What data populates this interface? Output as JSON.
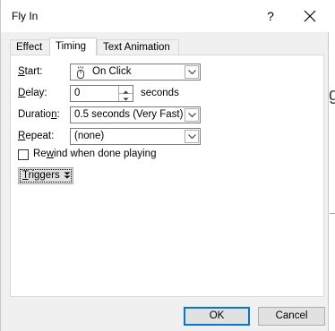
{
  "window": {
    "title": "Fly In"
  },
  "titlebar": {
    "help_label": "?"
  },
  "tabs": [
    {
      "label": "Effect",
      "active": false
    },
    {
      "label": "Timing",
      "active": true
    },
    {
      "label": "Text Animation",
      "active": false
    }
  ],
  "timing": {
    "start": {
      "label_key": "S",
      "label_rest": "tart:",
      "value": "On Click",
      "icon": "mouse-click-icon"
    },
    "delay": {
      "label_key": "D",
      "label_rest": "elay:",
      "value": "0",
      "unit": "seconds"
    },
    "duration": {
      "label_pre": "Duratio",
      "label_key": "n",
      "label_rest": ":",
      "value": "0.5 seconds (Very Fast)"
    },
    "repeat": {
      "label_key": "R",
      "label_rest": "epeat:",
      "value": "(none)"
    },
    "rewind": {
      "label_pre": "Re",
      "label_key": "w",
      "label_rest": "ind when done playing",
      "checked": false
    },
    "triggers": {
      "label_key": "T",
      "label_rest": "riggers",
      "icon": "double-chevron-down-icon"
    }
  },
  "buttons": {
    "ok": "OK",
    "cancel": "Cancel"
  },
  "background_fragment": "g",
  "colors": {
    "accent": "#0078d7",
    "panel": "#ffffff",
    "dialog": "#f0f0f0"
  }
}
